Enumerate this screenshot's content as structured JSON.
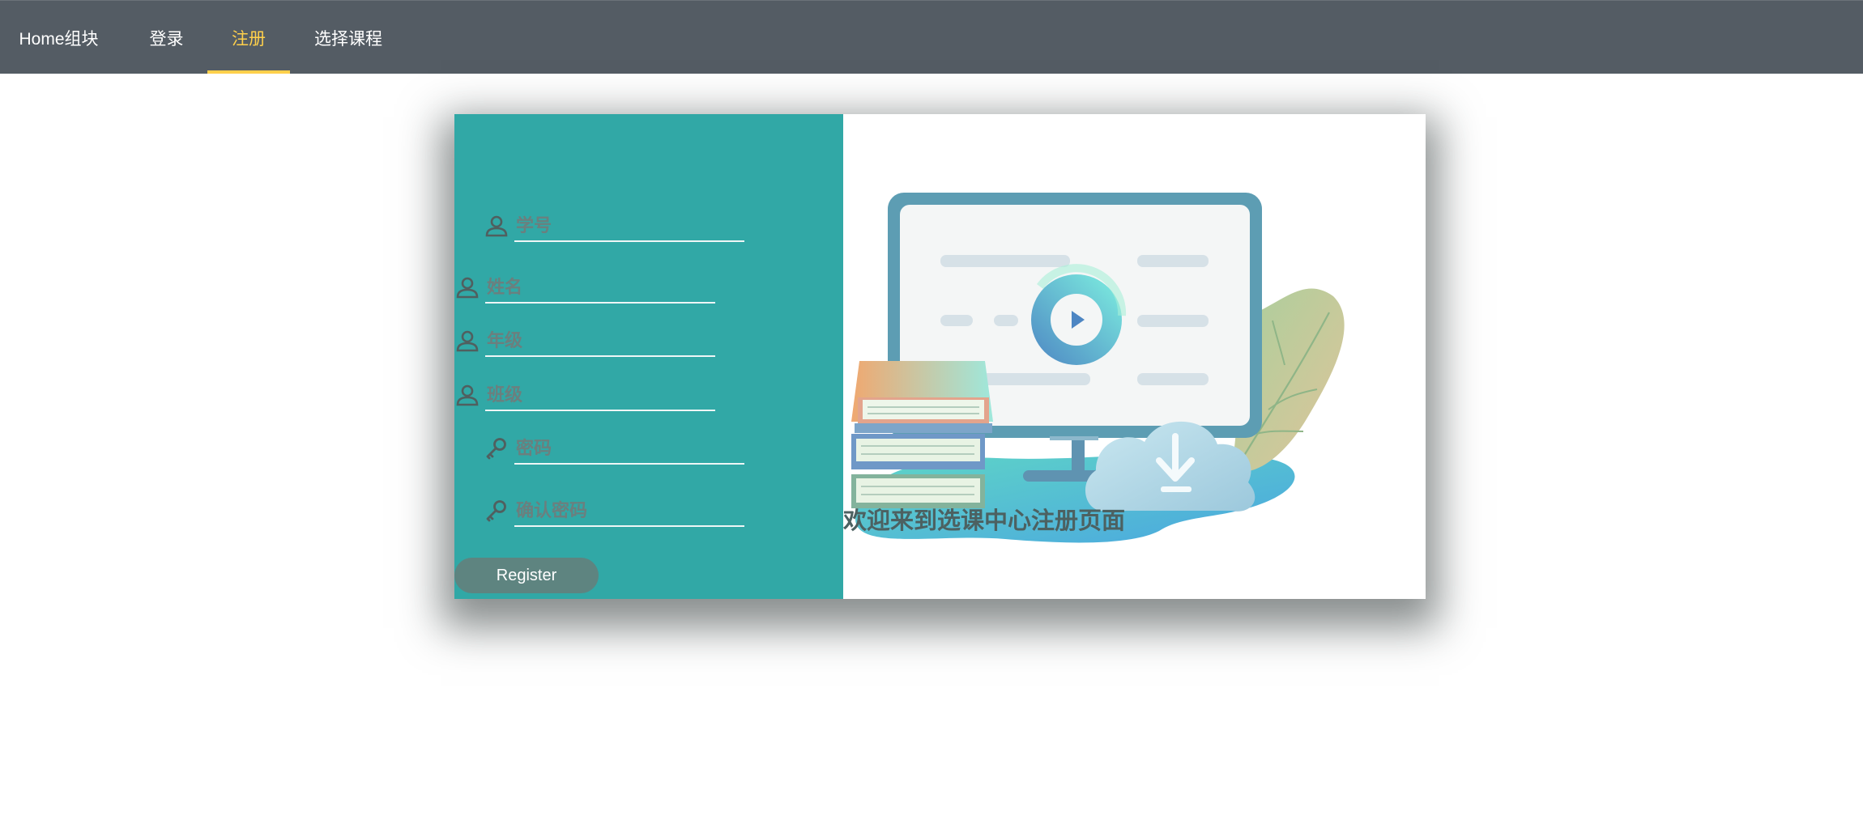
{
  "nav": {
    "items": [
      {
        "label": "Home组块"
      },
      {
        "label": "登录"
      },
      {
        "label": "注册",
        "active": true
      },
      {
        "label": "选择课程"
      }
    ],
    "active_color": "#ffd04b",
    "background": "#545c64"
  },
  "form": {
    "fields": [
      {
        "placeholder": "学号",
        "icon": "user-icon",
        "value": ""
      },
      {
        "placeholder": "姓名",
        "icon": "user-icon",
        "value": ""
      },
      {
        "placeholder": "年级",
        "icon": "user-icon",
        "value": ""
      },
      {
        "placeholder": "班级",
        "icon": "user-icon",
        "value": ""
      },
      {
        "placeholder": "密码",
        "icon": "key-icon",
        "value": ""
      },
      {
        "placeholder": "确认密码",
        "icon": "key-icon",
        "value": ""
      }
    ],
    "register_label": "Register",
    "panel_color": "#31a8a6"
  },
  "welcome": {
    "text": "欢迎来到选课中心注册页面"
  },
  "illustration": {
    "icon": "monitor-books-cloud-illustration"
  }
}
